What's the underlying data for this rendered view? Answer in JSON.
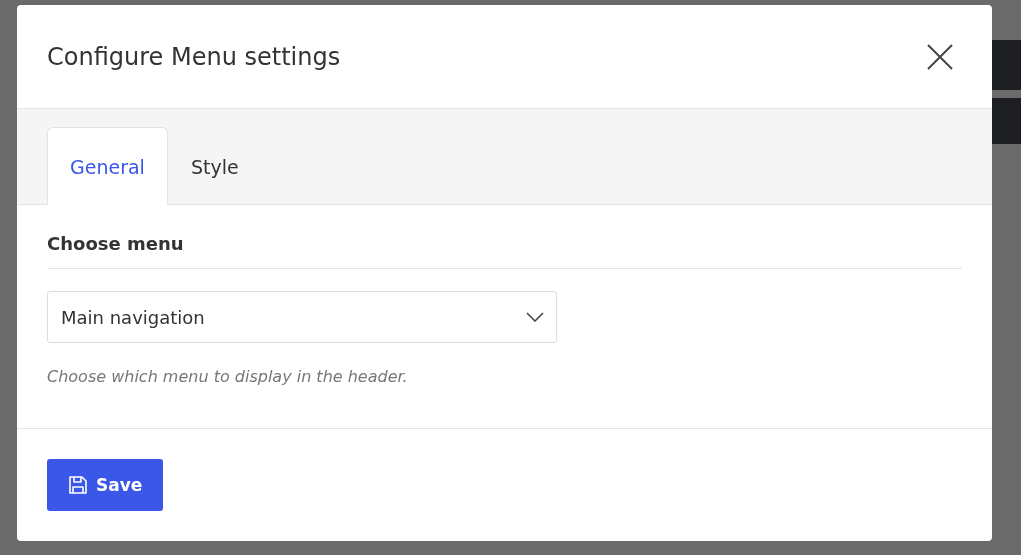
{
  "dialog": {
    "title": "Configure Menu settings"
  },
  "tabs": [
    {
      "label": "General",
      "selected": true
    },
    {
      "label": "Style",
      "selected": false
    }
  ],
  "section": {
    "heading": "Choose menu",
    "select": {
      "value": "Main navigation"
    },
    "help": "Choose which menu to display in the header."
  },
  "buttons": [
    {
      "label": "Save",
      "kind": "primary"
    }
  ]
}
